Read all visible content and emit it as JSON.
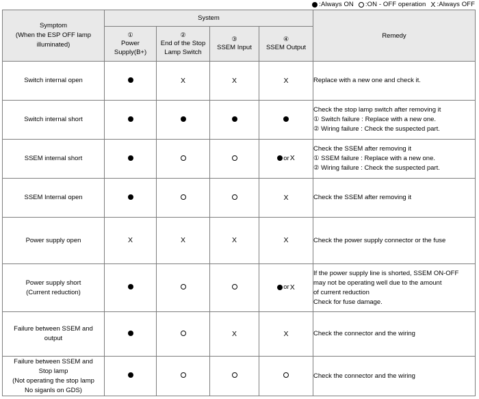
{
  "legend": {
    "items": [
      {
        "symbol": "filled-circle",
        "separator": ":",
        "text": "Always ON"
      },
      {
        "symbol": "open-circle",
        "separator": ":",
        "text": "ON - OFF operation"
      },
      {
        "symbol": "x-mark",
        "separator": ":",
        "text": "Always OFF"
      }
    ]
  },
  "table": {
    "headers": {
      "symptom": {
        "line1": "Symptom",
        "line2": "(When the ESP OFF lamp",
        "line3": "illuminated)"
      },
      "system_group": "System",
      "remedy": "Remedy",
      "columns": [
        {
          "number": "①",
          "label_line1": "Power Supply(B+)",
          "label_line2": ""
        },
        {
          "number": "②",
          "label_line1": "End of the Stop",
          "label_line2": "Lamp Switch"
        },
        {
          "number": "③",
          "label_line1": "SSEM Input",
          "label_line2": ""
        },
        {
          "number": "④",
          "label_line1": "SSEM Output",
          "label_line2": ""
        }
      ]
    },
    "rows": [
      {
        "symptom_lines": [
          "Switch internal open"
        ],
        "states": [
          "filled-circle",
          "x-mark",
          "x-mark",
          "x-mark"
        ],
        "remedy_lines": [
          "Replace with a new one and check it."
        ]
      },
      {
        "symptom_lines": [
          "Switch internal short"
        ],
        "states": [
          "filled-circle",
          "filled-circle",
          "filled-circle",
          "filled-circle"
        ],
        "remedy_lines": [
          "Check the stop lamp switch after removing it",
          "① Switch failure : Replace with a new one.",
          "② Wiring failure : Check the suspected part."
        ]
      },
      {
        "symptom_lines": [
          "SSEM internal short"
        ],
        "states": [
          "filled-circle",
          "open-circle",
          "open-circle",
          "filled-or-x"
        ],
        "remedy_lines": [
          "Check the SSEM after removing it",
          "① SSEM failure : Replace with a new one.",
          "② Wiring failure : Check the suspected part."
        ]
      },
      {
        "symptom_lines": [
          "SSEM Internal open"
        ],
        "states": [
          "filled-circle",
          "open-circle",
          "open-circle",
          "x-mark"
        ],
        "remedy_lines": [
          "Check the SSEM after removing it"
        ]
      },
      {
        "symptom_lines": [
          "Power supply open"
        ],
        "states": [
          "x-mark",
          "x-mark",
          "x-mark",
          "x-mark"
        ],
        "remedy_lines": [
          "Check the power supply connector or the fuse"
        ]
      },
      {
        "symptom_lines": [
          "Power supply short",
          "(Current reduction)"
        ],
        "states": [
          "filled-circle",
          "open-circle",
          "open-circle",
          "filled-or-x"
        ],
        "remedy_lines": [
          "If the power supply line is shorted, SSEM ON-OFF",
          "may not be operating well due to the amount",
          "of current reduction",
          "Check for fuse damage."
        ]
      },
      {
        "symptom_lines": [
          "Failure between SSEM and",
          "output"
        ],
        "states": [
          "filled-circle",
          "open-circle",
          "x-mark",
          "x-mark"
        ],
        "remedy_lines": [
          "Check the connector and the wiring"
        ]
      },
      {
        "symptom_lines": [
          "Failure between SSEM and",
          "Stop lamp",
          "(Not operating the stop lamp",
          "No siganls on GDS)"
        ],
        "states": [
          "filled-circle",
          "open-circle",
          "open-circle",
          "open-circle"
        ],
        "remedy_lines": [
          "Check the connector and the wiring"
        ]
      }
    ],
    "or_label": "or"
  },
  "colors": {
    "border": "#7d7d7d",
    "header_background": "#e9e9e9",
    "text": "#000000",
    "page_background": "#ffffff"
  }
}
